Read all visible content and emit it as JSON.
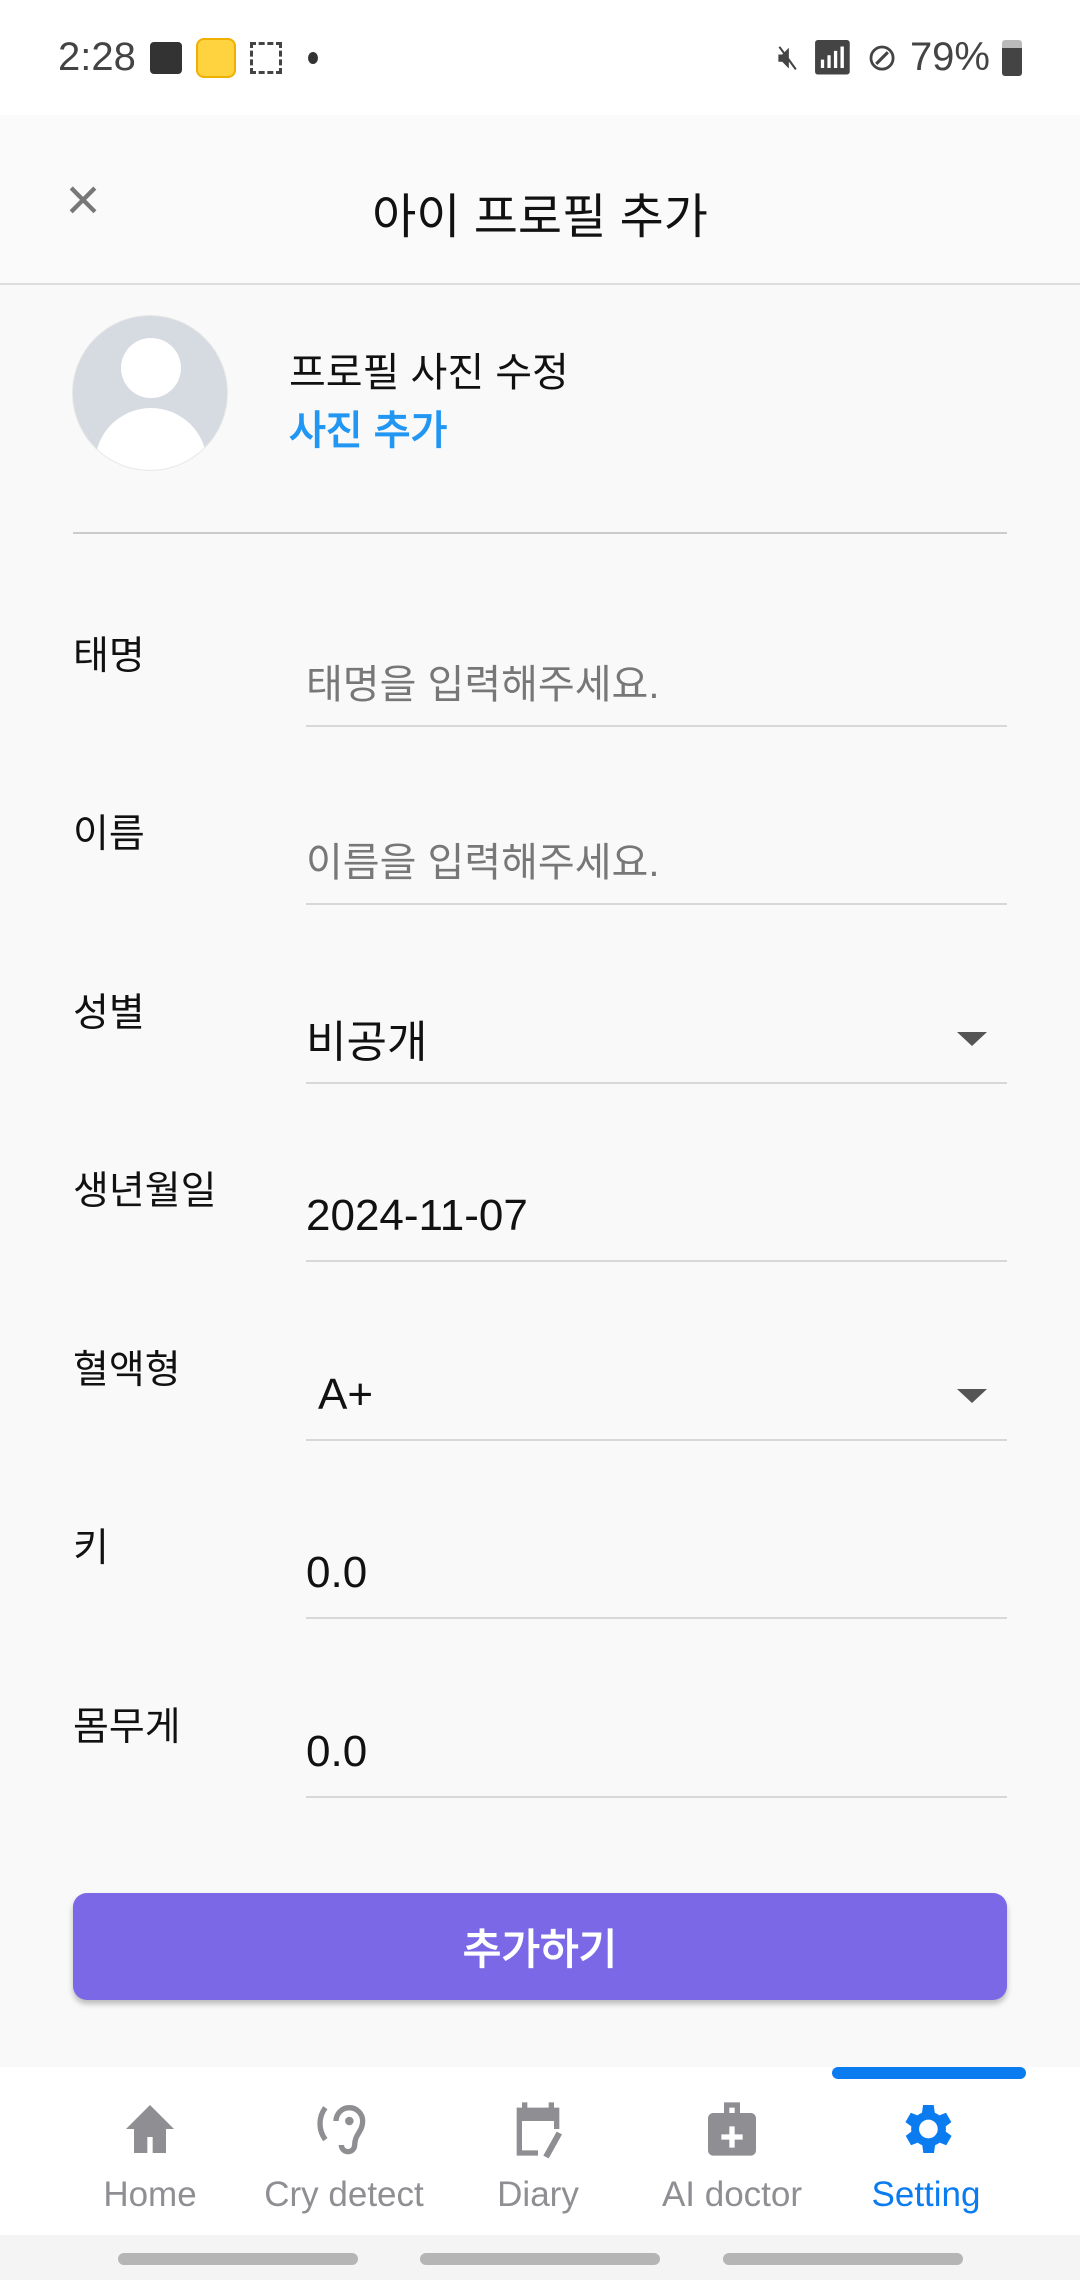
{
  "status": {
    "time": "2:28",
    "battery": "79%"
  },
  "header": {
    "title": "아이 프로필 추가"
  },
  "profile": {
    "title": "프로필 사진 수정",
    "add_photo": "사진 추가"
  },
  "fields": [
    {
      "label": "태명",
      "value": "",
      "placeholder": "태명을 입력해주세요."
    },
    {
      "label": "이름",
      "value": "",
      "placeholder": "이름을 입력해주세요."
    },
    {
      "label": "성별",
      "value": "비공개",
      "dropdown": true
    },
    {
      "label": "생년월일",
      "value": "2024-11-07"
    },
    {
      "label": "혈액형",
      "value": "A+",
      "dropdown": true
    },
    {
      "label": "키",
      "value": "0.0"
    },
    {
      "label": "몸무게",
      "value": "0.0"
    }
  ],
  "submit_label": "추가하기",
  "nav": [
    {
      "label": "Home"
    },
    {
      "label": "Cry detect"
    },
    {
      "label": "Diary"
    },
    {
      "label": "AI doctor"
    },
    {
      "label": "Setting",
      "active": true
    }
  ],
  "colors": {
    "accent": "#7b68e6",
    "link": "#2196f3",
    "nav_active": "#0a7cf0"
  }
}
